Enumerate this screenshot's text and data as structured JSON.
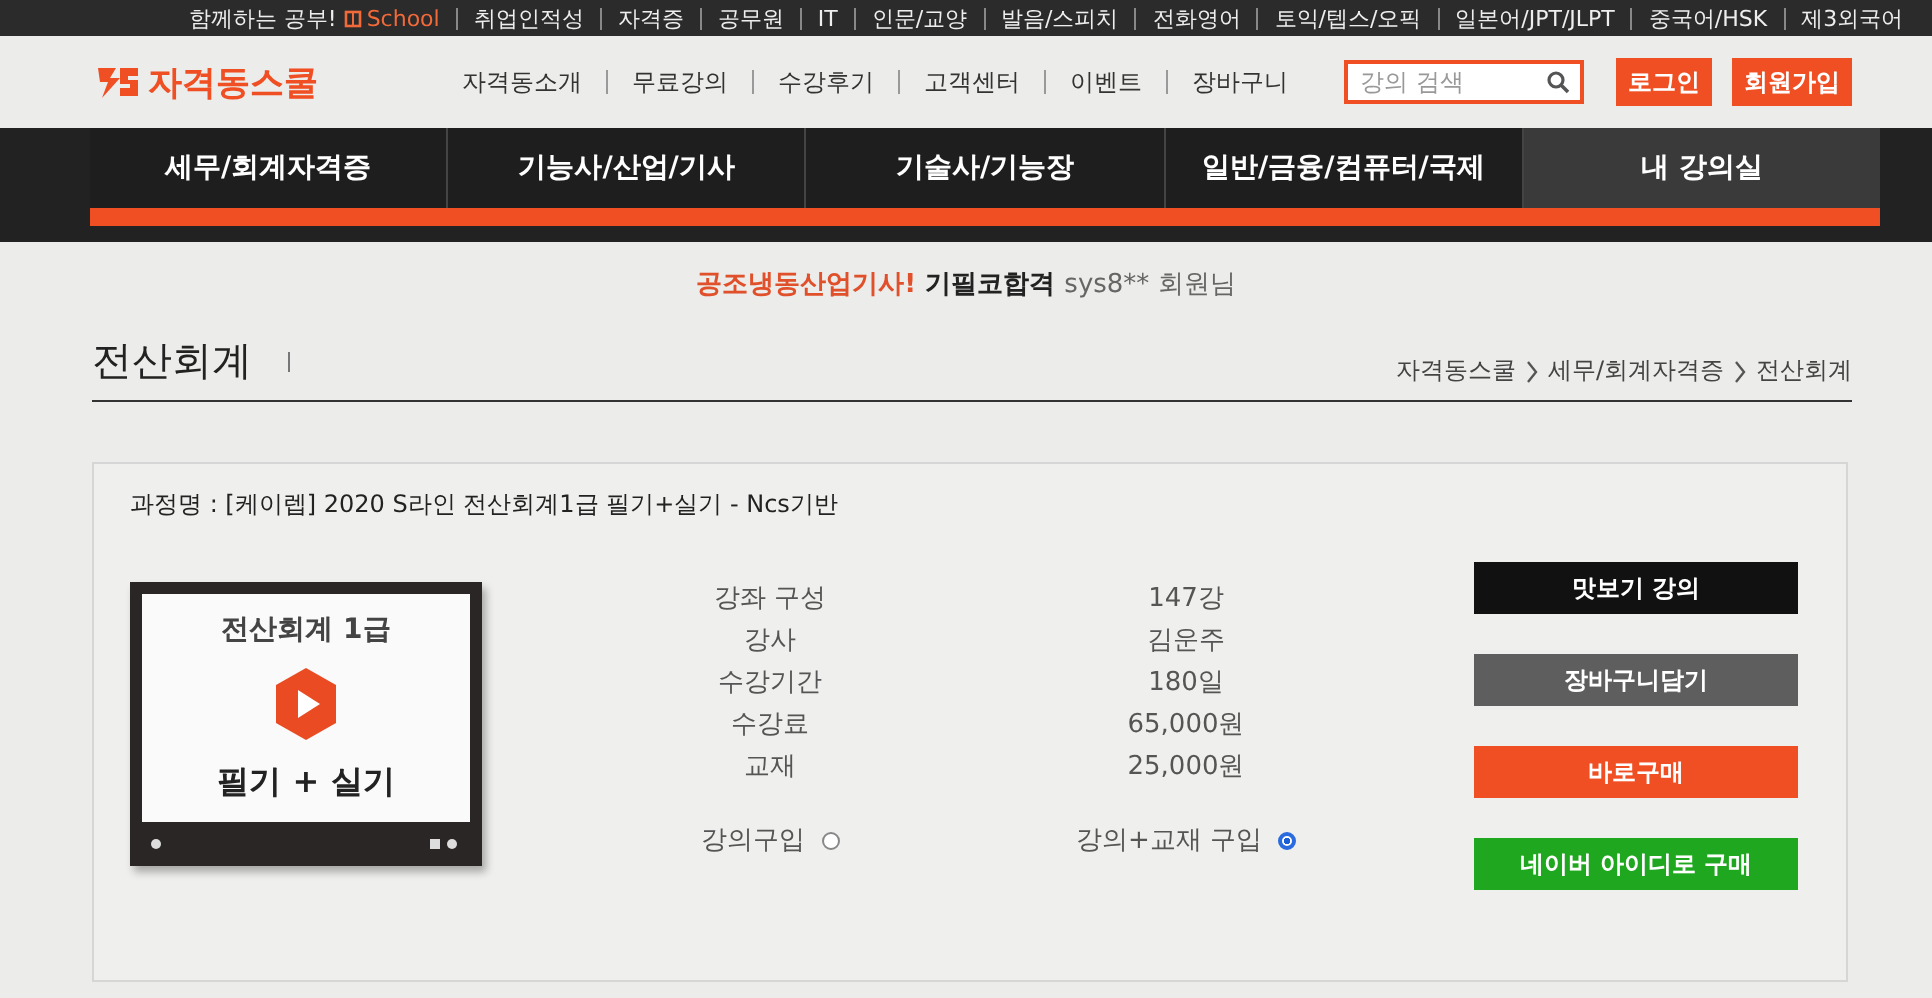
{
  "top_links": [
    {
      "label": "함께하는 공부!"
    },
    {
      "label": "School",
      "kind": "brand"
    },
    {
      "label": "취업인적성"
    },
    {
      "label": "자격증"
    },
    {
      "label": "공무원"
    },
    {
      "label": "IT"
    },
    {
      "label": "인문/교양"
    },
    {
      "label": "발음/스피치"
    },
    {
      "label": "전화영어"
    },
    {
      "label": "토익/텝스/오픽"
    },
    {
      "label": "일본어/JPT/JLPT"
    },
    {
      "label": "중국어/HSK"
    },
    {
      "label": "제3외국어"
    }
  ],
  "logo": {
    "text": "자격동스쿨"
  },
  "header_links": [
    "자격동소개",
    "무료강의",
    "수강후기",
    "고객센터",
    "이벤트",
    "장바구니"
  ],
  "search": {
    "placeholder": "강의 검색"
  },
  "header_buttons": [
    "로그인",
    "회원가입"
  ],
  "nav": [
    {
      "label": "세무/회계자격증",
      "selected": false
    },
    {
      "label": "기능사/산업/기사",
      "selected": false
    },
    {
      "label": "기술사/기능장",
      "selected": false
    },
    {
      "label": "일반/금융/컴퓨터/국제",
      "selected": false
    },
    {
      "label": "내 강의실",
      "selected": true
    }
  ],
  "greeting": {
    "highlight": "공조냉동산업기사!",
    "emphasis": "기필코합격",
    "member": "sys8** 회원님"
  },
  "page_title": "전산회계",
  "breadcrumb": [
    "자격동스쿨",
    "세무/회계자격증",
    "전산회계"
  ],
  "course": {
    "name": "과정명 : [케이렙] 2020 S라인 전산회계1급 필기+실기 - Ncs기반",
    "thumbnail": {
      "title": "전산회계 1급",
      "subtitle": "필기 + 실기"
    },
    "info": [
      {
        "label": "강좌 구성",
        "value": "147강"
      },
      {
        "label": "강사",
        "value": "김운주"
      },
      {
        "label": "수강기간",
        "value": "180일"
      },
      {
        "label": "수강료",
        "value": "65,000원"
      },
      {
        "label": "교재",
        "value": "25,000원"
      }
    ],
    "options": [
      {
        "label": "강의구입",
        "selected": false
      },
      {
        "label": "강의+교재 구입",
        "selected": true
      }
    ],
    "buttons": [
      {
        "label": "맛보기 강의",
        "kind": "dark"
      },
      {
        "label": "장바구니담기",
        "kind": "gray"
      },
      {
        "label": "바로구매",
        "kind": "orange"
      },
      {
        "label": "네이버 아이디로 구매",
        "kind": "green"
      }
    ]
  }
}
